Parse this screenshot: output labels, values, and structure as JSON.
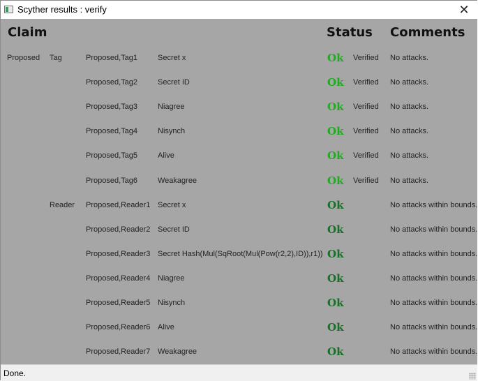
{
  "window": {
    "title": "Scyther results : verify",
    "close_icon": "✕"
  },
  "headers": {
    "claim": "Claim",
    "status": "Status",
    "comments": "Comments"
  },
  "colors": {
    "background": "#a6a6a6",
    "ok_verified": "#22aa22",
    "ok_bounded": "#1a6e2a"
  },
  "rows": [
    {
      "protocol": "Proposed",
      "role": "Tag",
      "claim_id": "Proposed,Tag1",
      "claim": "Secret x",
      "status": "Ok",
      "verified": "Verified",
      "comment": "No attacks."
    },
    {
      "protocol": "",
      "role": "",
      "claim_id": "Proposed,Tag2",
      "claim": "Secret ID",
      "status": "Ok",
      "verified": "Verified",
      "comment": "No attacks."
    },
    {
      "protocol": "",
      "role": "",
      "claim_id": "Proposed,Tag3",
      "claim": "Niagree",
      "status": "Ok",
      "verified": "Verified",
      "comment": "No attacks."
    },
    {
      "protocol": "",
      "role": "",
      "claim_id": "Proposed,Tag4",
      "claim": "Nisynch",
      "status": "Ok",
      "verified": "Verified",
      "comment": "No attacks."
    },
    {
      "protocol": "",
      "role": "",
      "claim_id": "Proposed,Tag5",
      "claim": "Alive",
      "status": "Ok",
      "verified": "Verified",
      "comment": "No attacks."
    },
    {
      "protocol": "",
      "role": "",
      "claim_id": "Proposed,Tag6",
      "claim": "Weakagree",
      "status": "Ok",
      "verified": "Verified",
      "comment": "No attacks."
    },
    {
      "protocol": "",
      "role": "Reader",
      "claim_id": "Proposed,Reader1",
      "claim": "Secret x",
      "status": "Ok",
      "verified": "",
      "comment": "No attacks within bounds."
    },
    {
      "protocol": "",
      "role": "",
      "claim_id": "Proposed,Reader2",
      "claim": "Secret ID",
      "status": "Ok",
      "verified": "",
      "comment": "No attacks within bounds."
    },
    {
      "protocol": "",
      "role": "",
      "claim_id": "Proposed,Reader3",
      "claim": "Secret Hash(Mul(SqRoot(Mul(Pow(r2,2),ID)),r1))",
      "status": "Ok",
      "verified": "",
      "comment": "No attacks within bounds."
    },
    {
      "protocol": "",
      "role": "",
      "claim_id": "Proposed,Reader4",
      "claim": "Niagree",
      "status": "Ok",
      "verified": "",
      "comment": "No attacks within bounds."
    },
    {
      "protocol": "",
      "role": "",
      "claim_id": "Proposed,Reader5",
      "claim": "Nisynch",
      "status": "Ok",
      "verified": "",
      "comment": "No attacks within bounds."
    },
    {
      "protocol": "",
      "role": "",
      "claim_id": "Proposed,Reader6",
      "claim": "Alive",
      "status": "Ok",
      "verified": "",
      "comment": "No attacks within bounds."
    },
    {
      "protocol": "",
      "role": "",
      "claim_id": "Proposed,Reader7",
      "claim": "Weakagree",
      "status": "Ok",
      "verified": "",
      "comment": "No attacks within bounds."
    }
  ],
  "statusbar": {
    "text": "Done."
  }
}
